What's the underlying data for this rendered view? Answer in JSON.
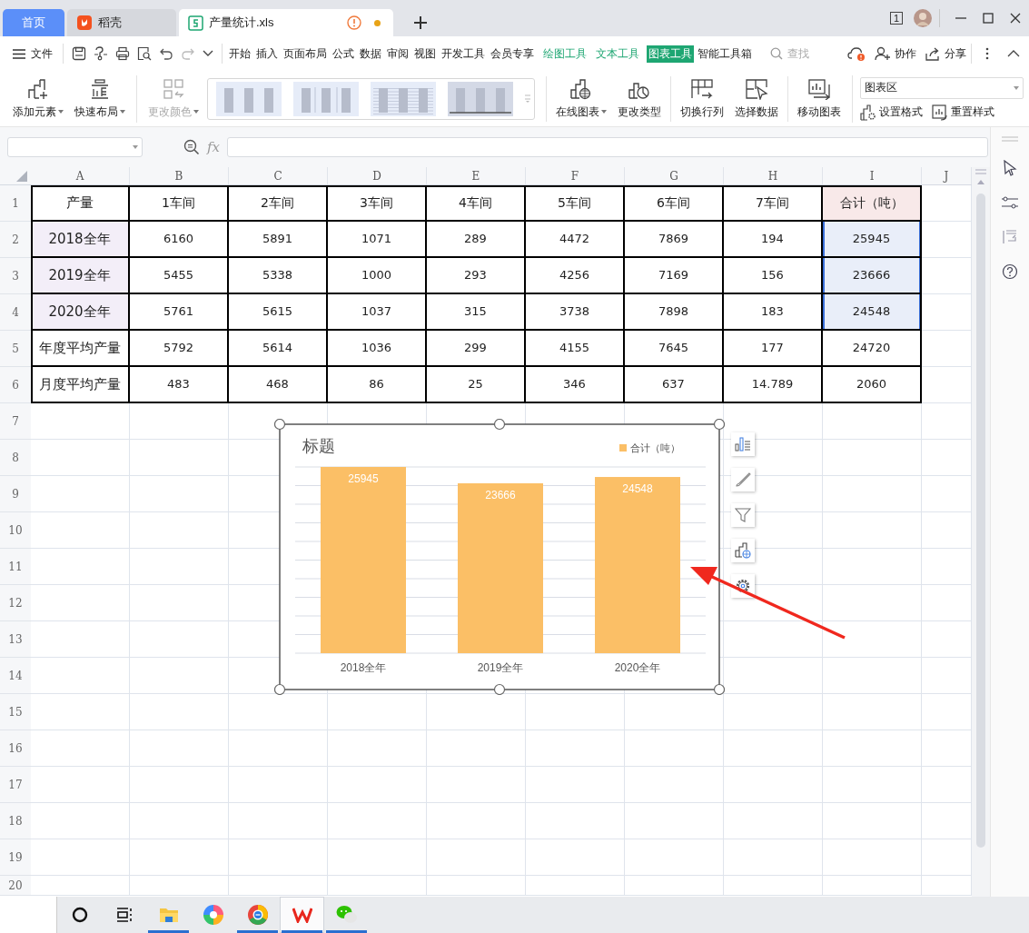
{
  "title_bar": {
    "tabs": [
      {
        "label": "首页",
        "kind": "home",
        "selected": false,
        "warning": false,
        "unsaved": false
      },
      {
        "label": "稻壳",
        "kind": "docer",
        "selected": false,
        "warning": false,
        "unsaved": false
      },
      {
        "label": "产量统计.xls",
        "kind": "sheet",
        "selected": true,
        "warning": true,
        "unsaved": true
      }
    ],
    "window_count": "1"
  },
  "menu_bar": {
    "file_label": "文件",
    "tabs": [
      {
        "label": "开始",
        "kind": "normal",
        "selected": false
      },
      {
        "label": "插入",
        "kind": "normal",
        "selected": false
      },
      {
        "label": "页面布局",
        "kind": "normal",
        "selected": false
      },
      {
        "label": "公式",
        "kind": "normal",
        "selected": false
      },
      {
        "label": "数据",
        "kind": "normal",
        "selected": false
      },
      {
        "label": "审阅",
        "kind": "normal",
        "selected": false
      },
      {
        "label": "视图",
        "kind": "normal",
        "selected": false
      },
      {
        "label": "开发工具",
        "kind": "normal",
        "selected": false
      },
      {
        "label": "会员专享",
        "kind": "normal",
        "selected": false
      },
      {
        "label": "绘图工具",
        "kind": "context",
        "selected": false
      },
      {
        "label": "文本工具",
        "kind": "context",
        "selected": false
      },
      {
        "label": "图表工具",
        "kind": "context",
        "selected": true
      },
      {
        "label": "智能工具箱",
        "kind": "normal",
        "selected": false
      }
    ],
    "search": {
      "placeholder": "查找"
    },
    "actions": [
      {
        "label": "协作",
        "kind": "collab"
      },
      {
        "label": "分享",
        "kind": "share"
      }
    ]
  },
  "ribbon": {
    "left_buttons": [
      {
        "label": "添加元素",
        "kind": "add",
        "dropdown": true,
        "disabled": false
      },
      {
        "label": "快速布局",
        "kind": "layout",
        "dropdown": true,
        "disabled": false
      },
      {
        "label": "更改颜色",
        "kind": "color",
        "dropdown": true,
        "disabled": true
      }
    ],
    "styles": [
      {
        "kind": "plain"
      },
      {
        "kind": "framed"
      },
      {
        "kind": "striped"
      },
      {
        "kind": "dark"
      }
    ],
    "right_buttons": [
      {
        "label": "在线图表",
        "kind": "online",
        "dropdown": true,
        "disabled": false,
        "group_start": true
      },
      {
        "label": "更改类型",
        "kind": "type",
        "dropdown": false,
        "disabled": false,
        "group_start": false
      },
      {
        "label": "切换行列",
        "kind": "switch",
        "dropdown": false,
        "disabled": false,
        "group_start": true
      },
      {
        "label": "选择数据",
        "kind": "select",
        "dropdown": false,
        "disabled": false,
        "group_start": false
      },
      {
        "label": "移动图表",
        "kind": "move",
        "dropdown": false,
        "disabled": false,
        "group_start": true
      }
    ],
    "element_select": {
      "value": "图表区"
    },
    "small_buttons": [
      {
        "label": "设置格式",
        "kind": "format"
      },
      {
        "label": "重置样式",
        "kind": "reset"
      }
    ]
  },
  "formula_bar": {
    "fx": "fx"
  },
  "sheet": {
    "columns": [
      "A",
      "B",
      "C",
      "D",
      "E",
      "F",
      "G",
      "H",
      "I",
      "J"
    ],
    "row_numbers": [
      "1",
      "2",
      "3",
      "4",
      "5",
      "6",
      "7",
      "8",
      "9",
      "10",
      "11",
      "12",
      "13",
      "14",
      "15",
      "16",
      "17",
      "18",
      "19",
      "20"
    ],
    "rows": [
      {
        "kind": "header",
        "cells": [
          "产量",
          "1车间",
          "2车间",
          "3车间",
          "4车间",
          "5车间",
          "6车间",
          "7车间",
          "合计（吨）"
        ],
        "label_ref": false,
        "total_ref": true
      },
      {
        "kind": "data",
        "cells": [
          "2018全年",
          "6160",
          "5891",
          "1071",
          "289",
          "4472",
          "7869",
          "194",
          "25945"
        ],
        "label_ref": true,
        "total_ref": true
      },
      {
        "kind": "data",
        "cells": [
          "2019全年",
          "5455",
          "5338",
          "1000",
          "293",
          "4256",
          "7169",
          "156",
          "23666"
        ],
        "label_ref": true,
        "total_ref": true
      },
      {
        "kind": "data",
        "cells": [
          "2020全年",
          "5761",
          "5615",
          "1037",
          "315",
          "3738",
          "7898",
          "183",
          "24548"
        ],
        "label_ref": true,
        "total_ref": true
      },
      {
        "kind": "data",
        "cells": [
          "年度平均产量",
          "5792",
          "5614",
          "1036",
          "299",
          "4155",
          "7645",
          "177",
          "24720"
        ],
        "label_ref": false,
        "total_ref": false
      },
      {
        "kind": "data",
        "cells": [
          "月度平均产量",
          "483",
          "468",
          "86",
          "25",
          "346",
          "637",
          "14.789",
          "2060"
        ],
        "label_ref": false,
        "total_ref": false
      }
    ]
  },
  "chart": {
    "chart_data": {
      "type": "bar",
      "title": "标题",
      "categories": [
        "2018全年",
        "2019全年",
        "2020全年"
      ],
      "series": [
        {
          "name": "合计（吨）",
          "color": "#fbbf66",
          "values": [
            25945,
            23666,
            24548
          ]
        }
      ],
      "data_labels": true
    },
    "side_buttons": [
      {
        "kind": "elements"
      },
      {
        "kind": "style"
      },
      {
        "kind": "filter"
      },
      {
        "kind": "online"
      },
      {
        "kind": "settings"
      }
    ]
  },
  "taskbar": {
    "items": [
      {
        "kind": "cortana",
        "running": false,
        "selected": false
      },
      {
        "kind": "taskview",
        "running": false,
        "selected": false
      },
      {
        "kind": "explorer",
        "running": true,
        "selected": false
      },
      {
        "kind": "pinwheel",
        "running": false,
        "selected": false
      },
      {
        "kind": "browser",
        "running": true,
        "selected": false
      },
      {
        "kind": "wps",
        "running": true,
        "selected": true
      },
      {
        "kind": "wechat",
        "running": true,
        "selected": false
      }
    ]
  }
}
